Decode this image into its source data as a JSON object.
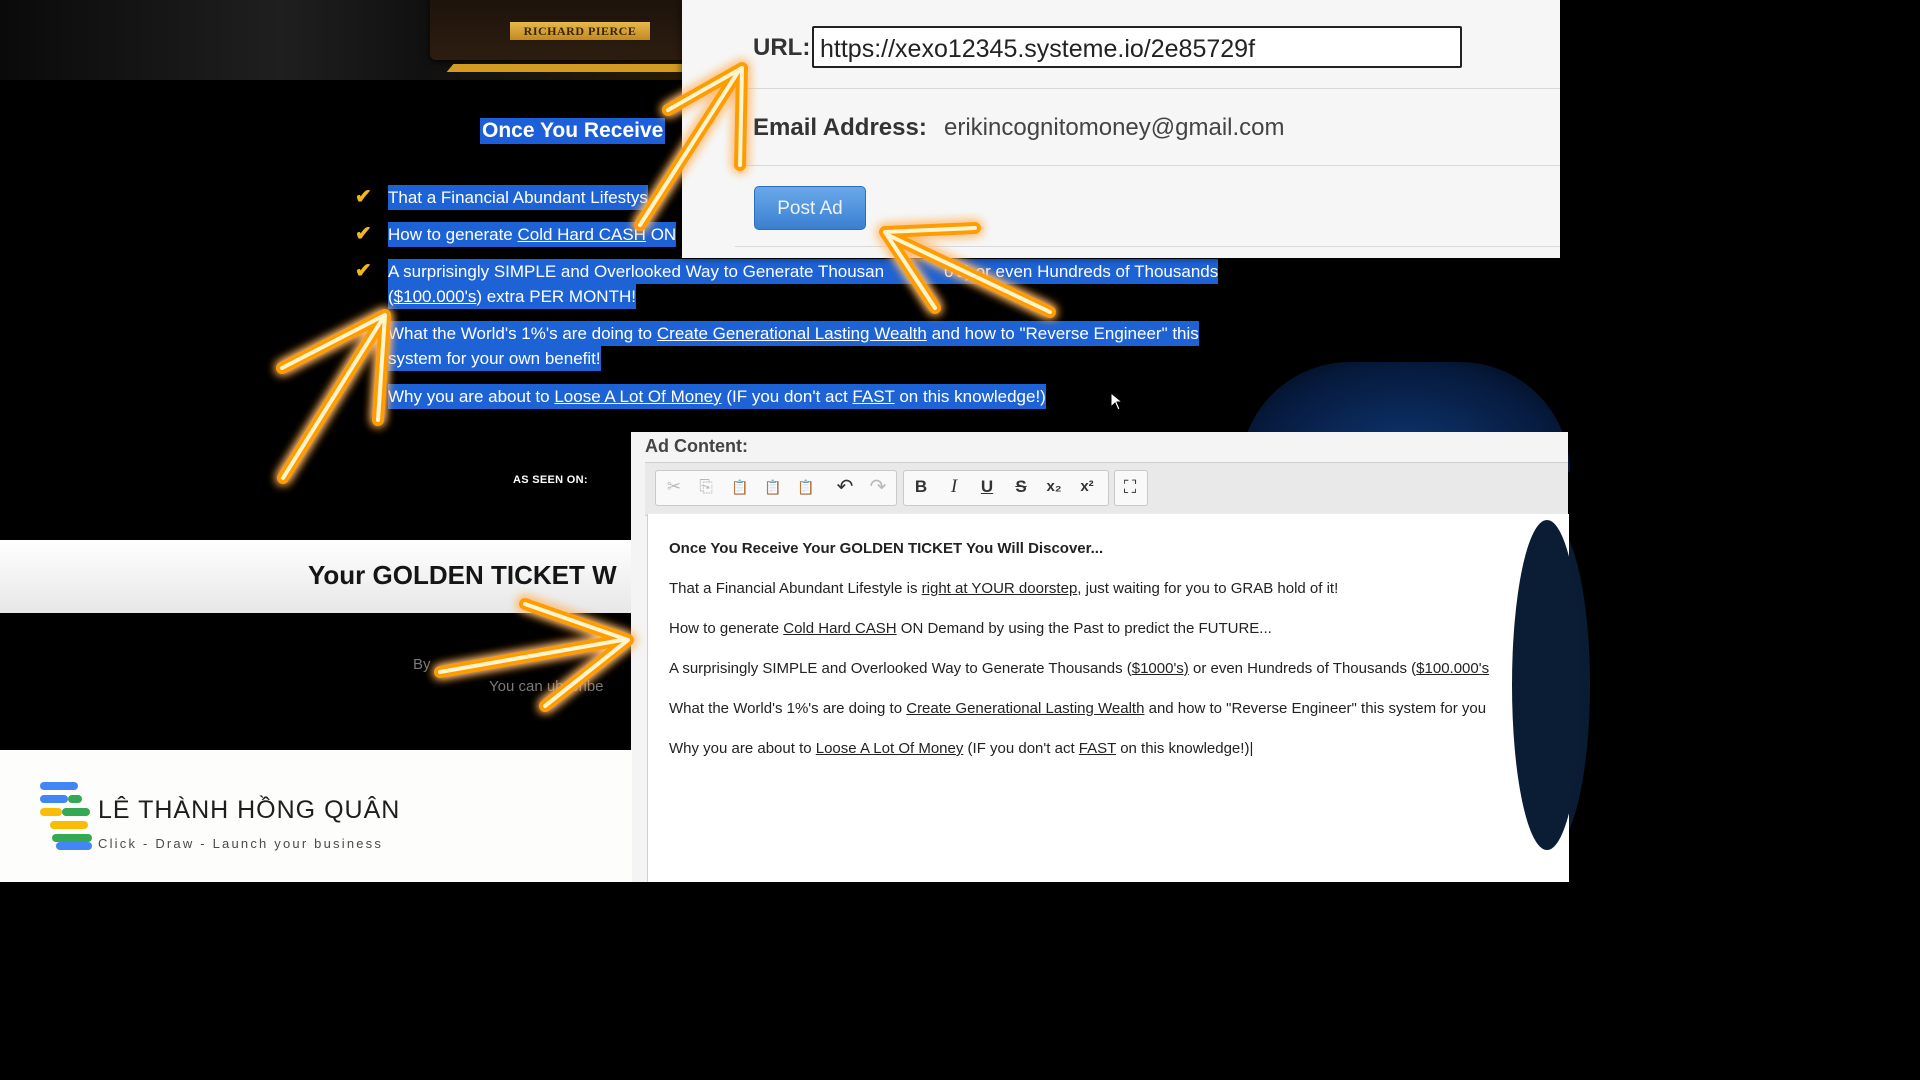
{
  "sales_page": {
    "book_label": "RICHARD PIERCE",
    "heading": "Once You Receive",
    "bullets": [
      {
        "a": "That a Financial Abundant Lifesty",
        "b": "",
        "c": "s"
      },
      {
        "a": "How to generate ",
        "b": "Cold Hard CASH",
        "c": " ON"
      },
      {
        "a": "A surprisingly SIMPLE and Overlooked Way to Generate Thousan",
        "b": "",
        "c": "0's) or even Hundreds of Thousands",
        "line2a": "(",
        "line2b": "$100.000's",
        "line2c": ") extra PER MONTH!"
      },
      {
        "a": "What the World's 1%'s are doing to ",
        "b": "Create Generational Lasting Wealth",
        "c": " and how to \"Reverse Engineer\" this",
        "line2a": "system for your own benefit!"
      },
      {
        "a": "Why you are about to ",
        "b": "Loose A Lot Of Money",
        "c": " (IF you don't act ",
        "d": "FAST",
        "e": " on this knowledge!)"
      }
    ],
    "as_seen_on": "AS SEEN ON:",
    "golden_title": "Your GOLDEN TICKET W",
    "footer_line1": "By",
    "footer_line2": "You can    ubscribe"
  },
  "url_panel": {
    "url_label": "URL:",
    "url_value": "https://xexo12345.systeme.io/2e85729f",
    "email_label": "Email Address:",
    "email_value": "erikincognitomoney@gmail.com",
    "post_ad_label": "Post Ad"
  },
  "editor": {
    "label": "Ad Content:",
    "toolbar": {
      "cut": "✂",
      "copy": "⎘",
      "paste": "📋",
      "paste_text": "📋",
      "paste_word": "📋",
      "undo": "↶",
      "redo": "↷",
      "bold": "B",
      "italic": "I",
      "underline": "U",
      "strike": "S",
      "subscript": "x₂",
      "superscript": "x²",
      "maximize": "⛶"
    },
    "lines": [
      {
        "parts": [
          "Once You Receive Your GOLDEN TICKET You Will Discover..."
        ]
      },
      {
        "parts": [
          "That a Financial Abundant Lifestyle is ",
          "right at YOUR doorstep",
          ", just waiting for you to GRAB hold of it!"
        ]
      },
      {
        "parts": [
          "How to generate ",
          "Cold Hard CASH",
          " ON Demand by using the Past to predict the FUTURE..."
        ]
      },
      {
        "parts": [
          "A surprisingly SIMPLE and Overlooked Way to Generate Thousands (",
          "$1000's)",
          " or even Hundreds of Thousands (",
          "$100.000's"
        ]
      },
      {
        "parts": [
          "What the World's 1%'s are doing to ",
          "Create Generational Lasting Wealth",
          " and how to \"Reverse Engineer\" this system for you"
        ]
      },
      {
        "parts": [
          "Why you are about to ",
          "Loose A Lot Of Money",
          " (IF you don't act ",
          "FAST",
          " on this knowledge!)"
        ]
      }
    ]
  },
  "brand": {
    "name": "LÊ THÀNH HỒNG QUÂN",
    "tagline": "Click - Draw - Launch your business"
  },
  "colors": {
    "highlight": "#1d63d6",
    "gold": "#f1b81b",
    "arrow_glow": "#ffae00",
    "button": "#3a7fd0"
  }
}
